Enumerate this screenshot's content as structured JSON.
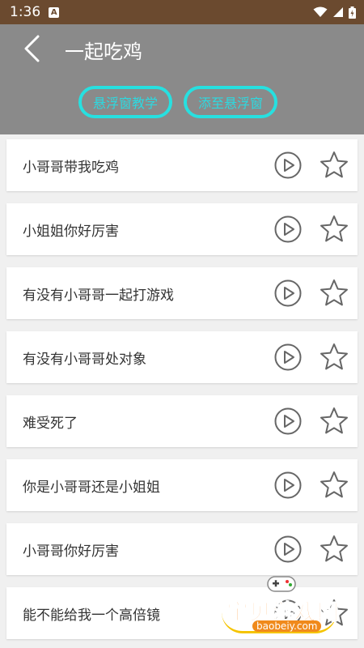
{
  "status_bar": {
    "time": "1:36",
    "notification_glyph": "A"
  },
  "header": {
    "title": "一起吃鸡",
    "buttons": [
      {
        "label": "悬浮窗教学"
      },
      {
        "label": "添至悬浮窗"
      }
    ]
  },
  "items": [
    {
      "text": "小哥哥带我吃鸡"
    },
    {
      "text": "小姐姐你好厉害"
    },
    {
      "text": "有没有小哥哥一起打游戏"
    },
    {
      "text": "有没有小哥哥处对象"
    },
    {
      "text": "难受死了"
    },
    {
      "text": "你是小哥哥还是小姐姐"
    },
    {
      "text": "小哥哥你好厉害"
    },
    {
      "text": "能不能给我一个高倍镜"
    }
  ],
  "watermark": {
    "name": "宝贝游戏网",
    "url": "baobeiy.com"
  },
  "colors": {
    "status_bar": "#6b4a2f",
    "header": "#8a8a8a",
    "pill_border": "#27e0e0",
    "icon_gray": "#666666"
  },
  "icons": {
    "back": "chevron-left-icon",
    "play": "play-circle-icon",
    "star": "star-outline-icon"
  }
}
